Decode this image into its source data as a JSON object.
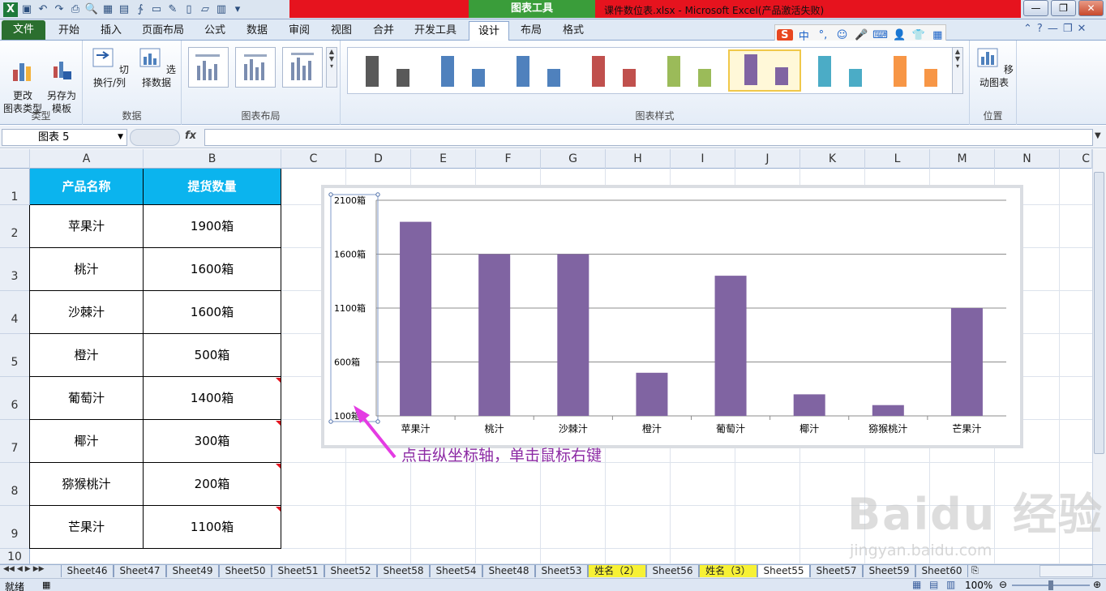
{
  "window": {
    "document_title": "课件数位表.xlsx - Microsoft Excel(产品激活失败)",
    "context_tab": "图表工具",
    "controls": [
      "—",
      "❐",
      "✕"
    ]
  },
  "tabs": [
    "文件",
    "开始",
    "插入",
    "页面布局",
    "公式",
    "数据",
    "审阅",
    "视图",
    "合并",
    "开发工具",
    "设计",
    "布局",
    "格式"
  ],
  "active_tab": "设计",
  "ime_bar": [
    "S",
    "中",
    "°,",
    "☺",
    "🎤",
    "⌨",
    "👤",
    "👕",
    "▦"
  ],
  "ribbon": {
    "type_group": {
      "label": "类型",
      "change_type": "更改\n图表类型",
      "save_template": "另存为\n模板"
    },
    "data_group": {
      "label": "数据",
      "switch": "切换行/列",
      "select": "选择数据"
    },
    "layout_group": {
      "label": "图表布局"
    },
    "styles_group": {
      "label": "图表样式",
      "style_colors": [
        "#595959",
        "#4f81bd",
        "#4f81bd",
        "#c0504d",
        "#9bbb59",
        "#8064a2",
        "#4bacc6",
        "#f79646"
      ],
      "selected_index": 5
    },
    "position_group": {
      "label": "位置",
      "move": "移动图表"
    }
  },
  "formula_bar": {
    "name_box": "图表 5",
    "fx": "fx",
    "content": ""
  },
  "columns": [
    "A",
    "B",
    "C",
    "D",
    "E",
    "F",
    "G",
    "H",
    "I",
    "J",
    "K",
    "L",
    "M",
    "N",
    "C"
  ],
  "rows": [
    "1",
    "2",
    "3",
    "4",
    "5",
    "6",
    "7",
    "8",
    "9",
    "10"
  ],
  "table": {
    "headers": [
      "产品名称",
      "提货数量"
    ],
    "rows": [
      [
        "苹果汁",
        "1900箱"
      ],
      [
        "桃汁",
        "1600箱"
      ],
      [
        "沙棘汁",
        "1600箱"
      ],
      [
        "橙汁",
        "500箱"
      ],
      [
        "葡萄汁",
        "1400箱"
      ],
      [
        "椰汁",
        "300箱"
      ],
      [
        "猕猴桃汁",
        "200箱"
      ],
      [
        "芒果汁",
        "1100箱"
      ]
    ]
  },
  "chart_data": {
    "type": "bar",
    "categories": [
      "苹果汁",
      "桃汁",
      "沙棘汁",
      "橙汁",
      "葡萄汁",
      "椰汁",
      "猕猴桃汁",
      "芒果汁"
    ],
    "values": [
      1900,
      1600,
      1600,
      500,
      1400,
      300,
      200,
      1100
    ],
    "y_ticks": [
      "100箱",
      "600箱",
      "1100箱",
      "1600箱",
      "2100箱"
    ],
    "ylim": [
      100,
      2100
    ],
    "bar_color": "#8064a2",
    "grid": true
  },
  "annotation": "点击纵坐标轴，单击鼠标右键",
  "sheet_nav": [
    "◀◀",
    "◀",
    "▶",
    "▶▶"
  ],
  "sheets": [
    {
      "name": "Sheet46",
      "style": "normal"
    },
    {
      "name": "Sheet47",
      "style": "normal"
    },
    {
      "name": "Sheet49",
      "style": "normal"
    },
    {
      "name": "Sheet50",
      "style": "normal"
    },
    {
      "name": "Sheet51",
      "style": "normal"
    },
    {
      "name": "Sheet52",
      "style": "normal"
    },
    {
      "name": "Sheet58",
      "style": "normal"
    },
    {
      "name": "Sheet54",
      "style": "normal"
    },
    {
      "name": "Sheet48",
      "style": "normal"
    },
    {
      "name": "Sheet53",
      "style": "normal"
    },
    {
      "name": "姓名（2）",
      "style": "yellow"
    },
    {
      "name": "Sheet56",
      "style": "normal"
    },
    {
      "name": "姓名（3）",
      "style": "yellow"
    },
    {
      "name": "Sheet55",
      "style": "active"
    },
    {
      "name": "Sheet57",
      "style": "normal"
    },
    {
      "name": "Sheet59",
      "style": "normal"
    },
    {
      "name": "Sheet60",
      "style": "normal"
    }
  ],
  "status": {
    "ready": "就绪",
    "zoom": "100%"
  },
  "watermark": {
    "brand": "Baidu 经验",
    "url": "jingyan.baidu.com"
  }
}
